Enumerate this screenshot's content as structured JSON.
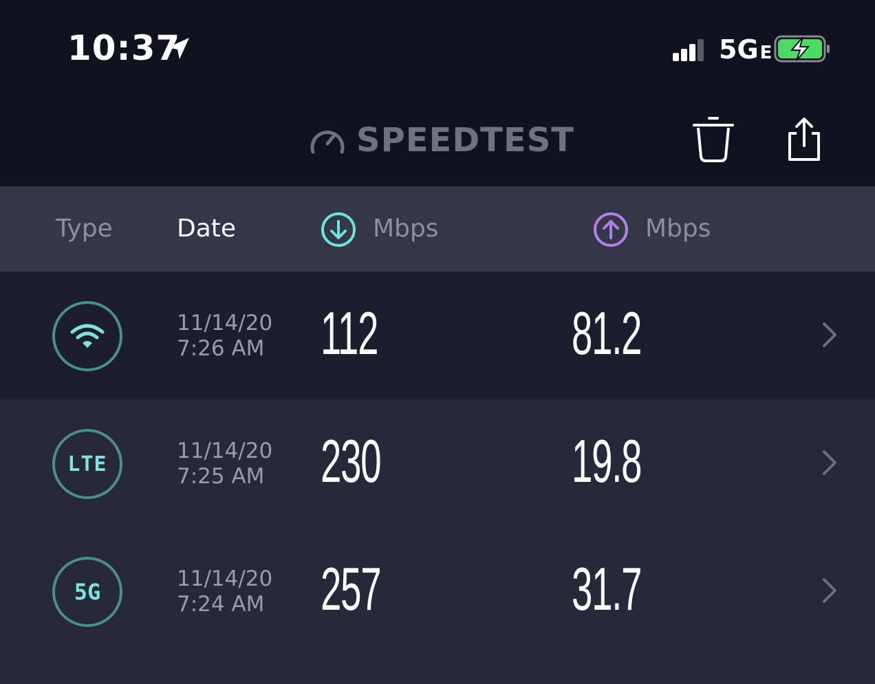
{
  "status_bar": {
    "time": "10:37",
    "network": "5G",
    "network_suffix": "E",
    "location_icon": "location-arrow-icon",
    "signal_icon": "cellular-signal-icon",
    "battery_icon": "battery-charging-icon",
    "battery_color": "#4cd964"
  },
  "header": {
    "logo_text": "SPEEDTEST",
    "logo_icon": "speedometer-icon",
    "delete_icon": "trash-icon",
    "share_icon": "share-icon"
  },
  "columns": {
    "type": "Type",
    "date": "Date",
    "download_unit": "Mbps",
    "upload_unit": "Mbps",
    "download_icon": "download-arrow-icon",
    "upload_icon": "upload-arrow-icon",
    "download_color": "#6fe3e0",
    "upload_color": "#b380f0"
  },
  "results": [
    {
      "type": "wifi",
      "type_label": "",
      "date": "11/14/20",
      "time": "7:26 AM",
      "download": "112",
      "upload": "81.2"
    },
    {
      "type": "lte",
      "type_label": "LTE",
      "date": "11/14/20",
      "time": "7:25 AM",
      "download": "230",
      "upload": "19.8"
    },
    {
      "type": "5g",
      "type_label": "5G",
      "date": "11/14/20",
      "time": "7:24 AM",
      "download": "257",
      "upload": "31.7"
    }
  ]
}
